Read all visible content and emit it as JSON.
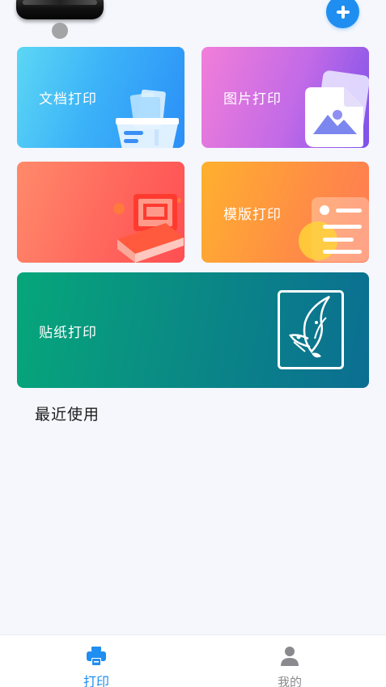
{
  "header": {
    "printer_image": "printer-device-image",
    "status_indicator": "status-dot",
    "add_button_icon": "plus-icon"
  },
  "cards": {
    "document": {
      "label": "文档打印",
      "icon": "document-box-icon"
    },
    "image": {
      "label": "图片打印",
      "icon": "image-picture-icon"
    },
    "red": {
      "label": "",
      "icon": "laptop-print-icon"
    },
    "template": {
      "label": "模版打印",
      "icon": "template-list-icon"
    },
    "sticker": {
      "label": "贴纸打印",
      "icon": "butterfly-sticker-icon"
    }
  },
  "recent": {
    "title": "最近使用"
  },
  "tabbar": {
    "tabs": [
      {
        "label": "打印",
        "icon": "printer-icon",
        "active": true
      },
      {
        "label": "我的",
        "icon": "person-icon",
        "active": false
      }
    ]
  },
  "colors": {
    "accent": "#1f8ef1",
    "background": "#f5f7fd",
    "inactive": "#8a8a8e"
  }
}
